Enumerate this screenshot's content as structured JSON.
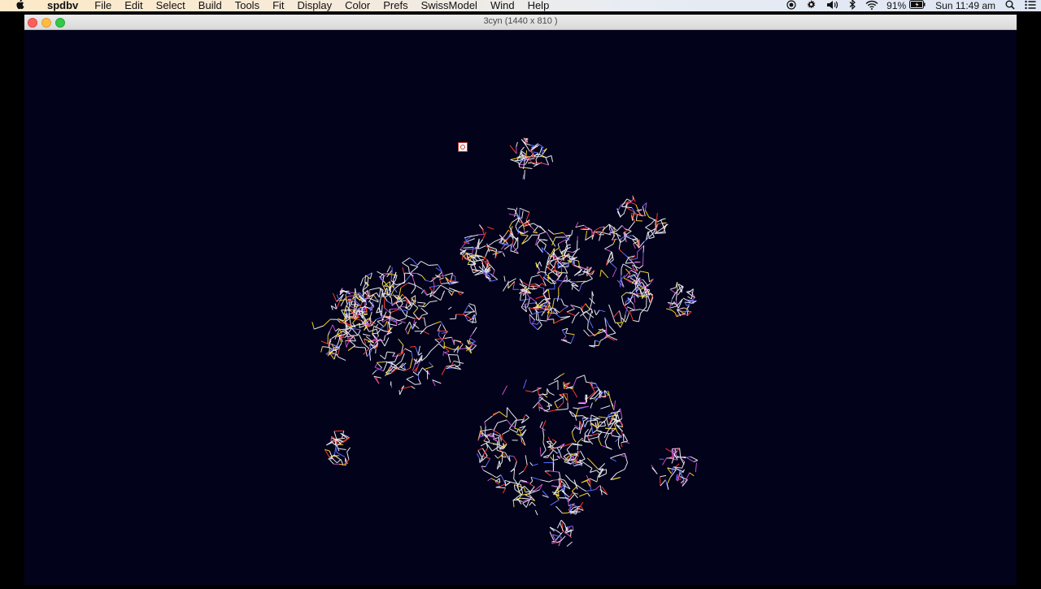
{
  "menubar": {
    "apple_icon": "apple-icon",
    "app_name": "spdbv",
    "menus": [
      "File",
      "Edit",
      "Select",
      "Build",
      "Tools",
      "Fit",
      "Display",
      "Color",
      "Prefs",
      "SwissModel",
      "Wind",
      "Help"
    ]
  },
  "status": {
    "battery": "91%",
    "clock": "Sun 11:49 am",
    "icons": [
      "record-icon",
      "settings-icon",
      "volume-icon",
      "bluetooth-icon",
      "wifi-icon",
      "battery-icon",
      "spotlight-icon",
      "notification-center-icon"
    ]
  },
  "window": {
    "title": "3cyn  (1440 x 810 )"
  },
  "viewer": {
    "background": "#02021a",
    "atom_colors": {
      "carbon": "#e8e8ee",
      "nitrogen": "#5a6cff",
      "oxygen": "#ff3a2a",
      "sulfur": "#f2d21a",
      "highlight": "#c850c8"
    }
  }
}
